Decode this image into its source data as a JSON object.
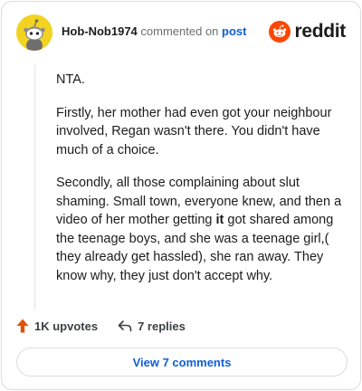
{
  "header": {
    "username": "Hob-Nob1974",
    "action_text": "commented on",
    "post_link_text": "post",
    "brand_name": "reddit",
    "avatar_icon": "snoo-avatar-icon",
    "brand_icon": "reddit-logo-icon"
  },
  "comment": {
    "paragraph_1": "NTA.",
    "paragraph_2": "Firstly, her mother had even got your neighbour involved, Regan wasn't there. You didn't have much of a choice.",
    "paragraph_3_before": "Secondly, all those complaining about slut shaming. Small town, everyone knew, and then a video of her mother getting ",
    "paragraph_3_bold": "it",
    "paragraph_3_after": " got shared among the teenage boys, and she was a teenage girl,( they already get hassled), she ran away. They know why, they just don't accept why."
  },
  "footer": {
    "upvotes": "1K upvotes",
    "replies": "7 replies",
    "upvote_icon": "upvote-arrow-icon",
    "reply_icon": "reply-arrow-icon"
  },
  "view_button_label": "View 7 comments",
  "colors": {
    "brand_orange": "#ff4500",
    "avatar_yellow": "#f3d322",
    "link_blue": "#0f5fd6",
    "upvote_orange": "#e0520c"
  }
}
